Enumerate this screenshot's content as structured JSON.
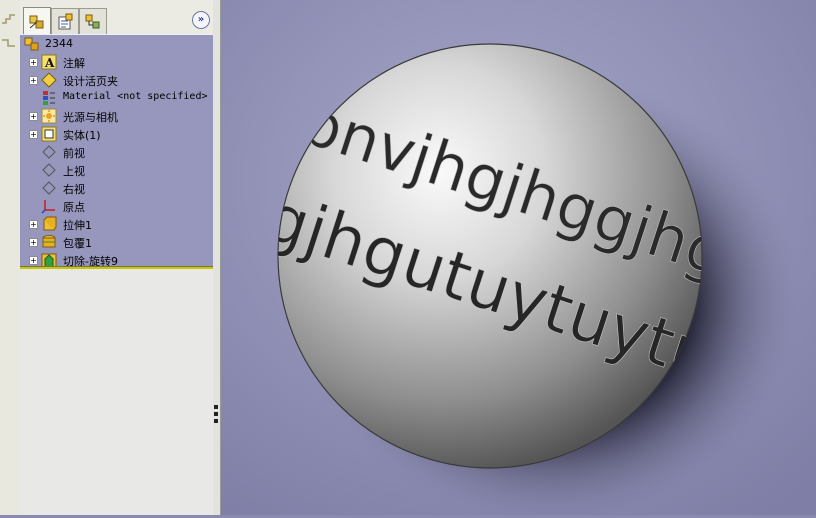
{
  "feature_manager": {
    "tabs": [
      {
        "name": "featuremanager-tab",
        "icon": "featuremanager-tree-icon"
      },
      {
        "name": "propertymanager-tab",
        "icon": "propertymanager-icon"
      },
      {
        "name": "configurationmanager-tab",
        "icon": "configurationmanager-icon"
      }
    ],
    "expand_label": "»",
    "tree": [
      {
        "label": "2344",
        "icon": "part-icon",
        "expandable": false,
        "root": true
      },
      {
        "label": "注解",
        "icon": "annotations-icon",
        "expandable": true
      },
      {
        "label": "设计活页夹",
        "icon": "design-binder-icon",
        "expandable": true
      },
      {
        "label": "Material <not specified>",
        "icon": "material-icon",
        "expandable": false,
        "mono": true
      },
      {
        "label": "光源与相机",
        "icon": "lights-cameras-icon",
        "expandable": true
      },
      {
        "label": "实体(1)",
        "icon": "solid-bodies-icon",
        "expandable": true
      },
      {
        "label": "前视",
        "icon": "plane-icon",
        "expandable": false
      },
      {
        "label": "上视",
        "icon": "plane-icon",
        "expandable": false
      },
      {
        "label": "右视",
        "icon": "plane-icon",
        "expandable": false
      },
      {
        "label": "原点",
        "icon": "origin-icon",
        "expandable": false
      },
      {
        "label": "拉伸1",
        "icon": "extrude-icon",
        "expandable": true
      },
      {
        "label": "包覆1",
        "icon": "wrap-icon",
        "expandable": true
      },
      {
        "label": "切除-旋转9",
        "icon": "cut-revolve-icon",
        "expandable": true
      }
    ]
  },
  "viewport": {
    "background": "#8a8ab0",
    "model": "sphere-with-wrapped-text",
    "text_upper": "bnvjhgjhggjhgjhgjhgjh",
    "text_lower": "gjhgutuytuytutuytu"
  },
  "colors": {
    "tree_bg": "#9797bd",
    "tree_end_bar": "#c8c800",
    "panel_bg": "#e6e6e4"
  }
}
